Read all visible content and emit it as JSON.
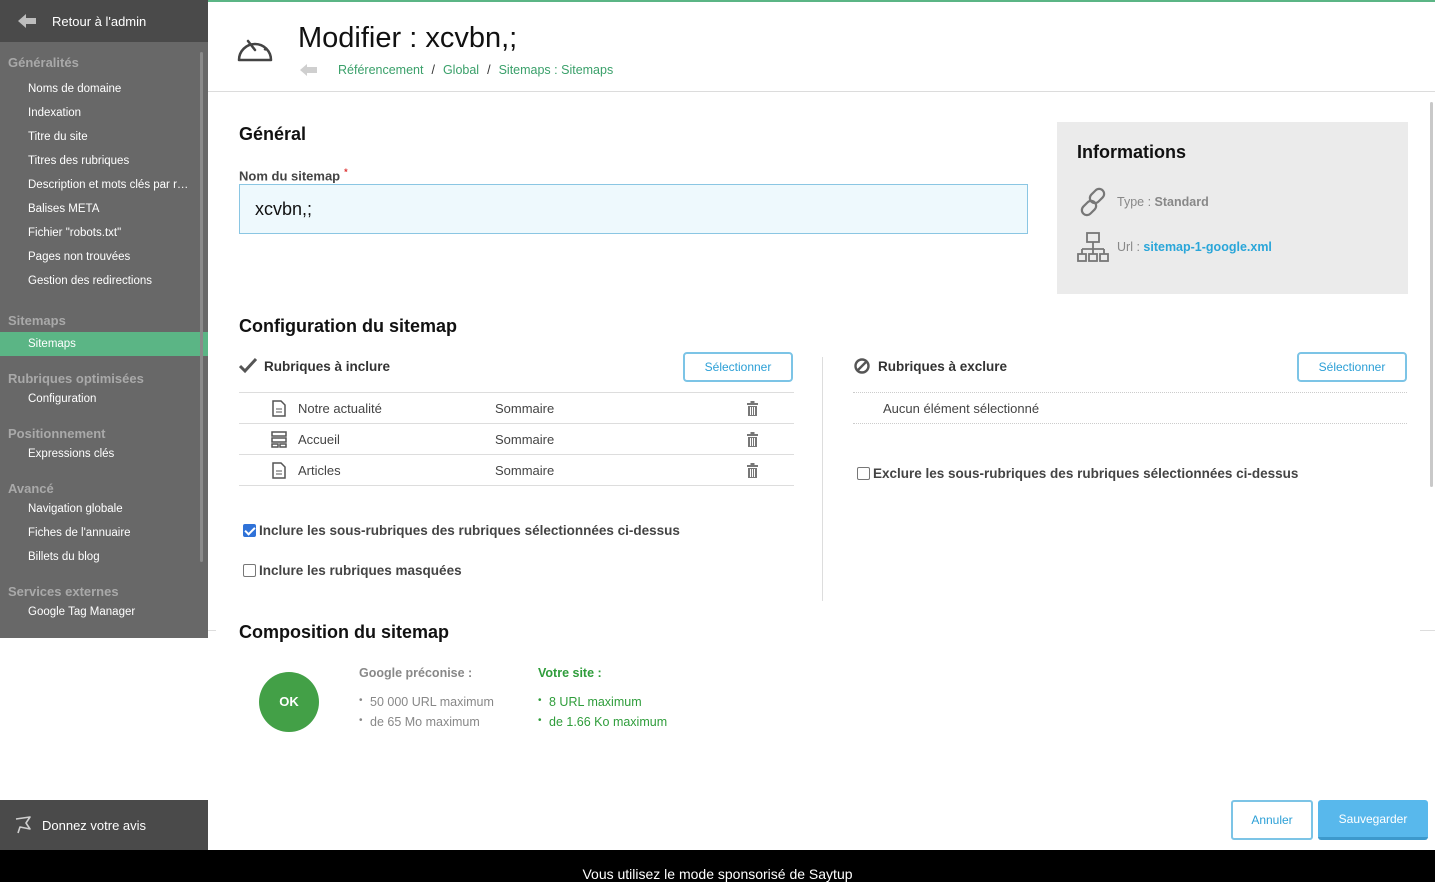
{
  "sidebar": {
    "back_label": "Retour à l'admin",
    "sections": [
      {
        "title": "Généralités",
        "items": [
          "Noms de domaine",
          "Indexation",
          "Titre du site",
          "Titres des rubriques",
          "Description et mots clés par rubrique",
          "Balises META",
          "Fichier \"robots.txt\"",
          "Pages non trouvées",
          "Gestion des redirections"
        ]
      },
      {
        "title": "Sitemaps",
        "items": [
          "Sitemaps"
        ]
      },
      {
        "title": "Rubriques optimisées",
        "items": [
          "Configuration"
        ]
      },
      {
        "title": "Positionnement",
        "items": [
          "Expressions clés"
        ]
      },
      {
        "title": "Avancé",
        "items": [
          "Navigation globale",
          "Fiches de l'annuaire",
          "Billets du blog"
        ]
      },
      {
        "title": "Services externes",
        "items": [
          "Google Tag Manager"
        ]
      }
    ],
    "active_item": "Sitemaps",
    "feedback_label": "Donnez votre avis"
  },
  "header": {
    "title": "Modifier : xcvbn,;",
    "breadcrumb": [
      "Référencement",
      "Global",
      "Sitemaps : Sitemaps"
    ],
    "breadcrumb_sep": "/"
  },
  "general": {
    "heading": "Général",
    "name_label": "Nom du sitemap",
    "required_mark": "*",
    "name_value": "xcvbn,;"
  },
  "info": {
    "title": "Informations",
    "type_label": "Type : ",
    "type_value": "Standard",
    "url_label": "Url : ",
    "url_value": "sitemap-1-google.xml"
  },
  "config": {
    "heading": "Configuration du sitemap",
    "include_title": "Rubriques à inclure",
    "exclude_title": "Rubriques à exclure",
    "select_label": "Sélectionner",
    "include_rows": [
      {
        "name": "Notre actualité",
        "type": "Sommaire",
        "icon": "page-icon"
      },
      {
        "name": "Accueil",
        "type": "Sommaire",
        "icon": "layout-icon"
      },
      {
        "name": "Articles",
        "type": "Sommaire",
        "icon": "page-icon"
      }
    ],
    "exclude_empty": "Aucun élément sélectionné",
    "include_sub_label": "Inclure les sous-rubriques des rubriques sélectionnées ci-dessus",
    "include_sub_checked": true,
    "include_hidden_label": "Inclure les rubriques masquées",
    "include_hidden_checked": false,
    "exclude_sub_label": "Exclure les sous-rubriques des rubriques sélectionnées ci-dessus",
    "exclude_sub_checked": false
  },
  "composition": {
    "heading": "Composition du sitemap",
    "status": "OK",
    "google_title": "Google préconise :",
    "google_items": [
      "50 000 URL maximum",
      "de 65 Mo maximum"
    ],
    "site_title": "Votre site :",
    "site_items": [
      "8 URL maximum",
      "de 1.66 Ko maximum"
    ]
  },
  "actions": {
    "cancel_label": "Annuler",
    "save_label": "Sauvegarder"
  },
  "footer_banner": "Vous utilisez le mode sponsorisé de Saytup",
  "colors": {
    "accent_green": "#5bb585",
    "link_blue": "#2aa6d9",
    "save_blue": "#58b8ec",
    "ok_green": "#43a047"
  }
}
